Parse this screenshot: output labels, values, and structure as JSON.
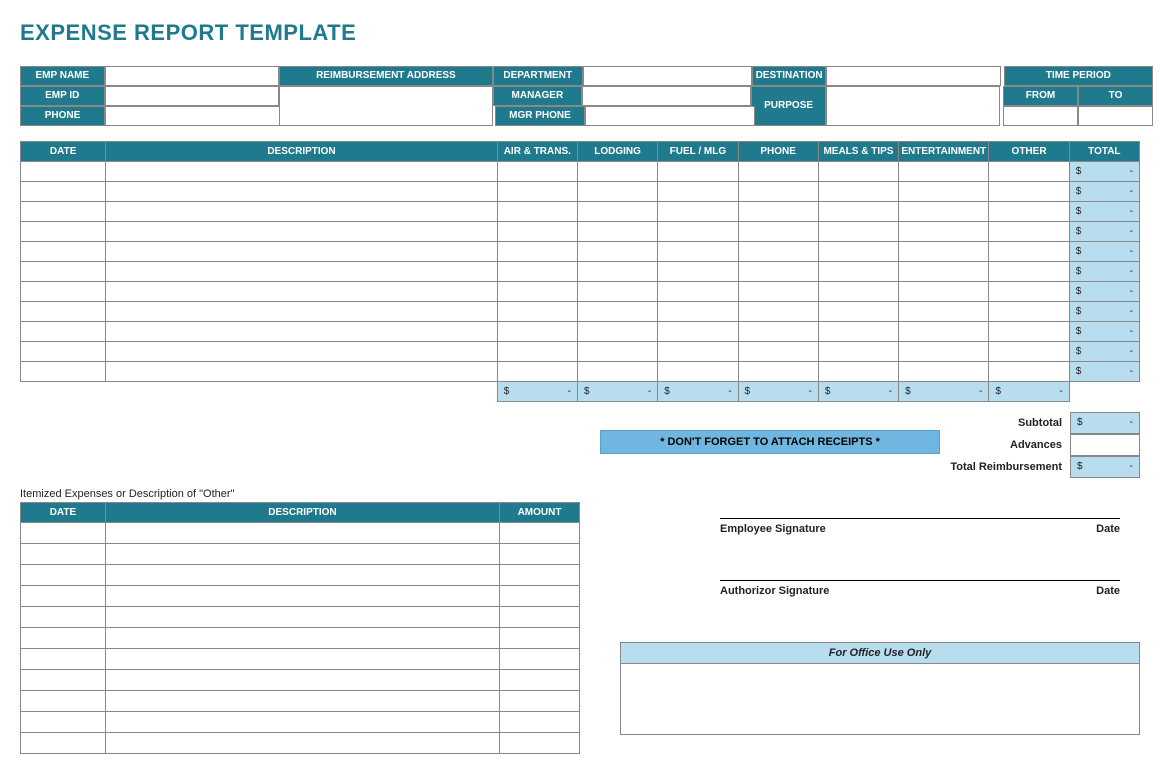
{
  "title": "EXPENSE REPORT TEMPLATE",
  "header": {
    "emp_name": "EMP NAME",
    "emp_id": "EMP ID",
    "phone": "PHONE",
    "reimb_addr": "REIMBURSEMENT ADDRESS",
    "department": "DEPARTMENT",
    "manager": "MANAGER",
    "mgr_phone": "MGR PHONE",
    "destination": "DESTINATION",
    "purpose": "PURPOSE",
    "time_period": "TIME PERIOD",
    "from": "FROM",
    "to": "TO"
  },
  "cols": {
    "date": "DATE",
    "desc": "DESCRIPTION",
    "air": "AIR & TRANS.",
    "lodging": "LODGING",
    "fuel": "FUEL / MLG",
    "phone": "PHONE",
    "meals": "MEALS & TIPS",
    "ent": "ENTERTAINMENT",
    "other": "OTHER",
    "total": "TOTAL"
  },
  "money": {
    "dollar": "$",
    "dash": "-"
  },
  "summary": {
    "subtotal": "Subtotal",
    "advances": "Advances",
    "total_reimb": "Total Reimbursement"
  },
  "receipts_note": "* DON'T FORGET TO ATTACH RECEIPTS *",
  "itemized": {
    "label": "Itemized Expenses or Description of \"Other\"",
    "date": "DATE",
    "desc": "DESCRIPTION",
    "amount": "AMOUNT"
  },
  "sig": {
    "emp": "Employee Signature",
    "auth": "Authorizor Signature",
    "date": "Date"
  },
  "office": "For Office Use Only"
}
